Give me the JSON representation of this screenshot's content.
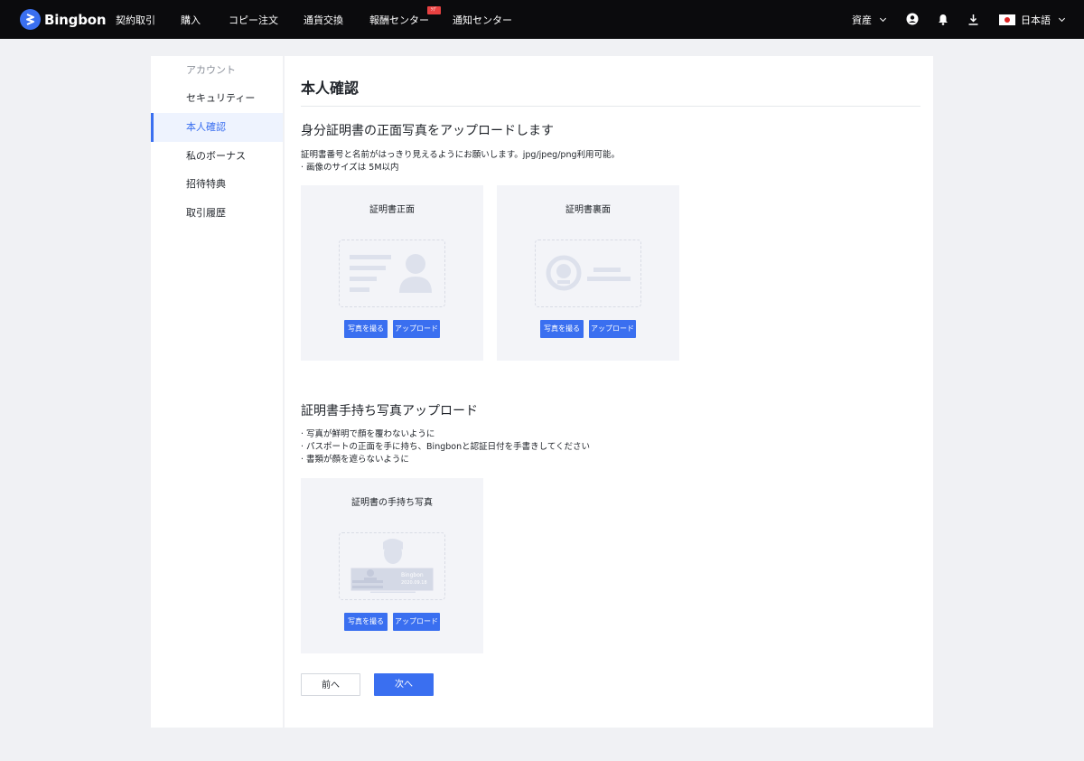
{
  "brand": {
    "name": "Bingbon"
  },
  "nav": {
    "items": [
      "契約取引",
      "購入",
      "コピー注文",
      "通貨交換",
      "報酬センター",
      "通知センター"
    ],
    "hot_badge": "ﾂｸﾞ",
    "assets": "資産",
    "language": "日本語"
  },
  "sidebar": {
    "header": "アカウント",
    "items": [
      "セキュリティー",
      "本人確認",
      "私のボーナス",
      "招待特典",
      "取引履歴"
    ],
    "active": "本人確認"
  },
  "main": {
    "title": "本人確認",
    "section1": {
      "title": "身分証明書の正面写真をアップロードします",
      "desc_line1": "証明書番号と名前がはっきり見えるようにお願いします。jpg/jpeg/png利用可能。",
      "desc_line2": "· 画像のサイズは 5M以内",
      "cards": [
        {
          "title": "証明書正面",
          "take_label": "写真を撮る",
          "upload_label": "アップロード"
        },
        {
          "title": "証明書裏面",
          "take_label": "写真を撮る",
          "upload_label": "アップロード"
        }
      ]
    },
    "section2": {
      "title": "証明書手持ち写真アップロード",
      "desc_line1": "· 写真が鮮明で顔を覆わないように",
      "desc_line2": "· パスポートの正面を手に持ち、Bingbonと認証日付を手書きしてください",
      "desc_line3": "· 書類が顔を遮らないように",
      "card": {
        "title": "証明書の手持ち写真",
        "take_label": "写真を撮る",
        "upload_label": "アップロード",
        "illus_text1": "Bingbon",
        "illus_text2": "2020.09.18"
      }
    },
    "prev_label": "前へ",
    "next_label": "次へ"
  },
  "colors": {
    "accent": "#3a6ff0",
    "topbar": "#0b0b0d",
    "card_bg": "#f3f4f8"
  }
}
